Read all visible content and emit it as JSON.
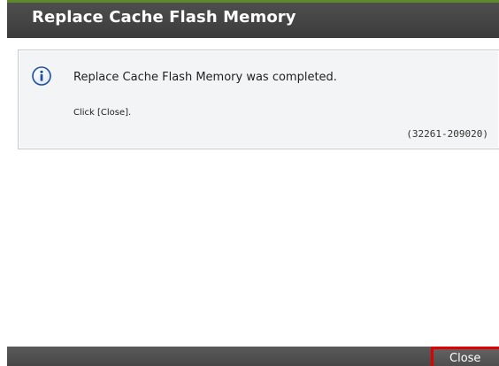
{
  "dialog": {
    "title": "Replace Cache Flash Memory",
    "message": {
      "icon": "info-icon",
      "text": "Replace Cache Flash Memory was completed.",
      "instruction": "Click [Close].",
      "code": "(32261-209020)"
    },
    "footer": {
      "close_label": "Close"
    }
  },
  "colors": {
    "title_bar": "#464646",
    "title_accent": "#5d8a2a",
    "message_bg": "#f3f4f5",
    "footer_bar": "#4f4f4f",
    "close_highlight": "#e00000",
    "info_icon_blue": "#1f4f9a"
  }
}
